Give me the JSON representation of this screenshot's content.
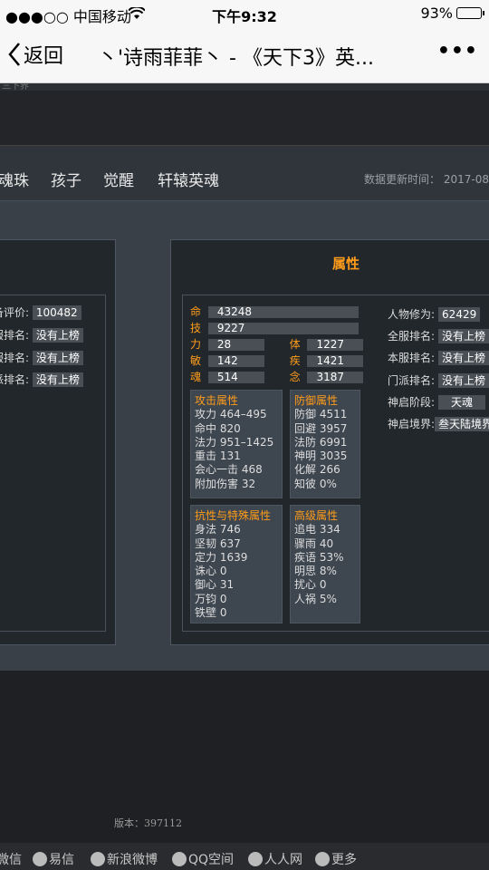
{
  "status_bar": {
    "carrier": "●●●○○ 中国移动",
    "time": "下午9:32",
    "battery": "93%",
    "battery_level": 0.93
  },
  "nav": {
    "back_label": "返回",
    "title": "丶'诗雨菲菲丶 - 《天下3》英...",
    "more_label": "•••"
  },
  "top_strip": "三下界",
  "tabs": [
    "魂珠",
    "孩子",
    "觉醒",
    "轩辕英魂"
  ],
  "update_time": "数据更新时间： 2017-08",
  "left_panel": {
    "rows": [
      {
        "label": "备评价:",
        "value": "100482"
      },
      {
        "label": "服排名:",
        "value": "没有上榜"
      },
      {
        "label": "服排名:",
        "value": "没有上榜"
      },
      {
        "label": "派排名:",
        "value": "没有上榜"
      }
    ]
  },
  "attributes": {
    "title": "属性",
    "main": [
      {
        "key": "命",
        "value": "43248"
      },
      {
        "key": "技",
        "value": "9227"
      }
    ],
    "pairs": [
      {
        "k1": "力",
        "v1": "28",
        "k2": "体",
        "v2": "1227"
      },
      {
        "k1": "敏",
        "v1": "142",
        "k2": "疾",
        "v2": "1421"
      },
      {
        "k1": "魂",
        "v1": "514",
        "k2": "念",
        "v2": "3187"
      }
    ],
    "attack": {
      "head": "攻击属性",
      "lines": [
        "攻力 464–495",
        "命中 820",
        "法力 951–1425",
        "重击 131",
        "会心一击 468",
        "附加伤害 32"
      ]
    },
    "defense": {
      "head": "防御属性",
      "lines": [
        "防御 4511",
        "回避 3957",
        "法防 6991",
        "神明 3035",
        "化解 266",
        "知彼 0%"
      ]
    },
    "resist": {
      "head": "抗性与特殊属性",
      "lines": [
        "身法 746",
        "坚韧 637",
        "定力 1639",
        "诛心 0",
        "御心 31",
        "万钧 0",
        "铁壁 0"
      ]
    },
    "advanced": {
      "head": "高级属性",
      "lines": [
        "追电 334",
        "骤雨 40",
        "疾语 53%",
        "明思 8%",
        "扰心 0",
        "人祸 5%"
      ]
    },
    "right_col": [
      {
        "label": "人物修为:",
        "value": "62429"
      },
      {
        "label": "全服排名:",
        "value": "没有上榜"
      },
      {
        "label": "本服排名:",
        "value": "没有上榜"
      },
      {
        "label": "门派排名:",
        "value": "没有上榜"
      },
      {
        "label": "神启阶段:",
        "value": "天魂"
      },
      {
        "label": "神启境界:",
        "value": "叁天陆境界"
      }
    ]
  },
  "version": "版本：397112",
  "share": [
    "微信",
    "易信",
    "新浪微博",
    "QQ空间",
    "人人网",
    "更多"
  ]
}
